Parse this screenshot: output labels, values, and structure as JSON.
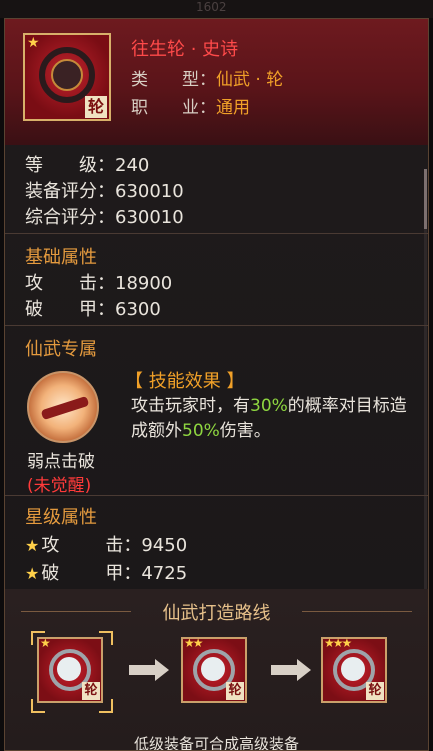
{
  "top_text": "1602",
  "item": {
    "name": "往生轮 · 史诗",
    "type_label": "类　　型：",
    "type_value": "仙武 · 轮",
    "job_label": "职　　业：",
    "job_value": "通用",
    "badge": "轮",
    "stars": 1
  },
  "stats": {
    "level_label": "等　　级：",
    "level_value": "240",
    "equip_score_label": "装备评分：",
    "equip_score_value": "630010",
    "total_score_label": "综合评分：",
    "total_score_value": "630010"
  },
  "base_attrs": {
    "title": "基础属性",
    "attack_label": "攻　　击：",
    "attack_value": "18900",
    "armor_label": "破　　甲：",
    "armor_value": "6300"
  },
  "exclusive": {
    "title": "仙武专属",
    "skill_name": "弱点击破",
    "skill_state": "(未觉醒)",
    "effect_title": "【 技能效果 】",
    "effect_part1": "攻击玩家时，有",
    "effect_pct1": "30%",
    "effect_part2": "的概率对目标造成额外",
    "effect_pct2": "50%",
    "effect_part3": "伤害。"
  },
  "star_attrs": {
    "title": "星级属性",
    "attack_label": "攻",
    "attack_sep": "击：",
    "attack_value": "9450",
    "armor_label": "破",
    "armor_sep": "甲：",
    "armor_value": "4725"
  },
  "route": {
    "title": "仙武打造路线",
    "items": [
      {
        "stars": "★",
        "badge": "轮"
      },
      {
        "stars": "★★",
        "badge": "轮"
      },
      {
        "stars": "★★★",
        "badge": "轮"
      }
    ],
    "footer": "低级装备可合成高级装备"
  },
  "colors": {
    "name": "#ff4a4a",
    "value_orange": "#f0a028",
    "section": "#e49a3e",
    "highlight": "#8ed640",
    "unawakened": "#ff3a3a"
  }
}
